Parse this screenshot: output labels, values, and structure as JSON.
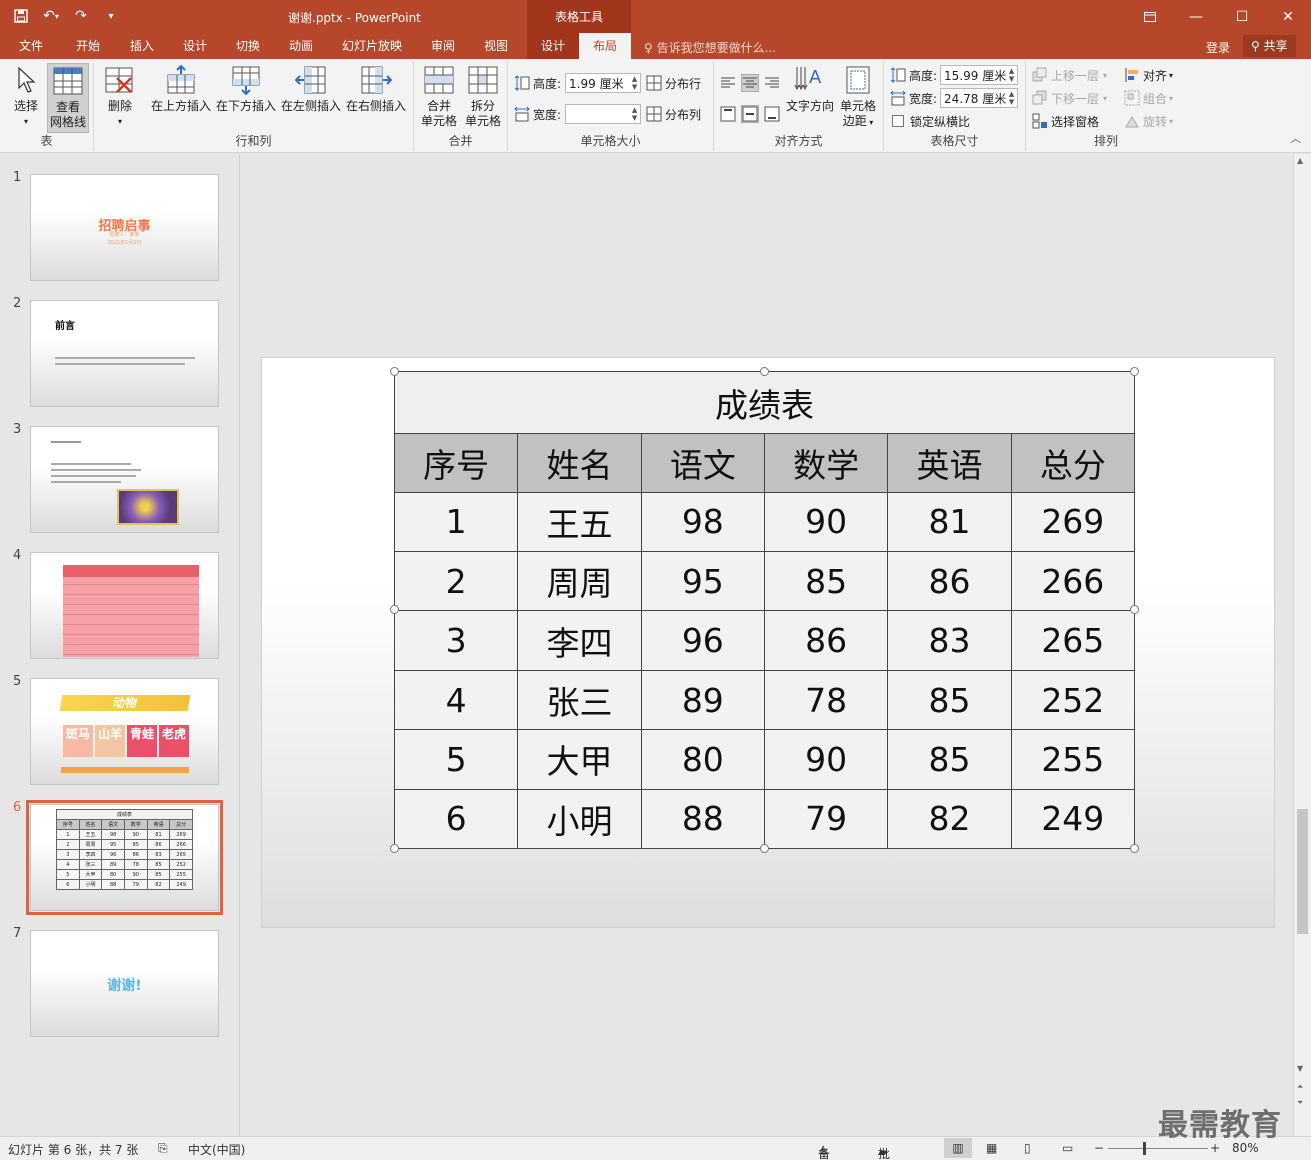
{
  "titlebar": {
    "file_title": "谢谢.pptx - PowerPoint",
    "contextual_label": "表格工具"
  },
  "tabs": [
    "文件",
    "开始",
    "插入",
    "设计",
    "切换",
    "动画",
    "幻灯片放映",
    "审阅",
    "视图",
    "设计",
    "布局"
  ],
  "tellme": "告诉我您想要做什么...",
  "login": "登录",
  "share": "共享",
  "ribbon": {
    "group_table": {
      "label": "表",
      "select": "选择",
      "gridlines_line1": "查看",
      "gridlines_line2": "网格线"
    },
    "group_rowscols": {
      "label": "行和列",
      "delete": "删除",
      "insert_above": "在上方插入",
      "insert_below": "在下方插入",
      "insert_left": "在左侧插入",
      "insert_right": "在右侧插入"
    },
    "group_merge": {
      "label": "合并",
      "merge_line1": "合并",
      "merge_line2": "单元格",
      "split_line1": "拆分",
      "split_line2": "单元格"
    },
    "group_cellsize": {
      "label": "单元格大小",
      "height_label": "高度:",
      "height_value": "1.99 厘米",
      "width_label": "宽度:",
      "width_value": "",
      "distribute_rows": "分布行",
      "distribute_cols": "分布列"
    },
    "group_align": {
      "label": "对齐方式",
      "text_direction": "文字方向",
      "margins_line1": "单元格",
      "margins_line2": "边距"
    },
    "group_tablesize": {
      "label": "表格尺寸",
      "height_label": "高度:",
      "height_value": "15.99 厘米",
      "width_label": "宽度:",
      "width_value": "24.78 厘米",
      "lock_ratio": "锁定纵横比"
    },
    "group_arrange": {
      "label": "排列",
      "bring_forward": "上移一层",
      "send_backward": "下移一层",
      "selection_pane": "选择窗格",
      "align": "对齐",
      "group": "组合",
      "rotate": "旋转"
    }
  },
  "thumbnails": {
    "numbers": [
      "1",
      "2",
      "3",
      "4",
      "5",
      "6",
      "7"
    ],
    "slide1_title": "招聘启事",
    "slide1_sub1": "招聘人：某某",
    "slide1_sub2": "2021年1月1日",
    "slide2_title": "前言",
    "slide5_title": "动物",
    "slide5_tiles": [
      "斑马",
      "山羊",
      "青蛙",
      "老虎"
    ],
    "slide7_text": "谢谢!"
  },
  "table": {
    "title": "成绩表",
    "headers": [
      "序号",
      "姓名",
      "语文",
      "数学",
      "英语",
      "总分"
    ],
    "rows": [
      [
        "1",
        "王五",
        "98",
        "90",
        "81",
        "269"
      ],
      [
        "2",
        "周周",
        "95",
        "85",
        "86",
        "266"
      ],
      [
        "3",
        "李四",
        "96",
        "86",
        "83",
        "265"
      ],
      [
        "4",
        "张三",
        "89",
        "78",
        "85",
        "252"
      ],
      [
        "5",
        "大甲",
        "80",
        "90",
        "85",
        "255"
      ],
      [
        "6",
        "小明",
        "88",
        "79",
        "82",
        "249"
      ]
    ]
  },
  "statusbar": {
    "slide_info": "幻灯片 第 6 张，共 7 张",
    "language": "中文(中国)",
    "notes": "备注",
    "comments": "批注",
    "zoom": "80%"
  },
  "watermark": "最需教育",
  "colors": {
    "accent": "#b7472a",
    "selection": "#e0633f"
  }
}
